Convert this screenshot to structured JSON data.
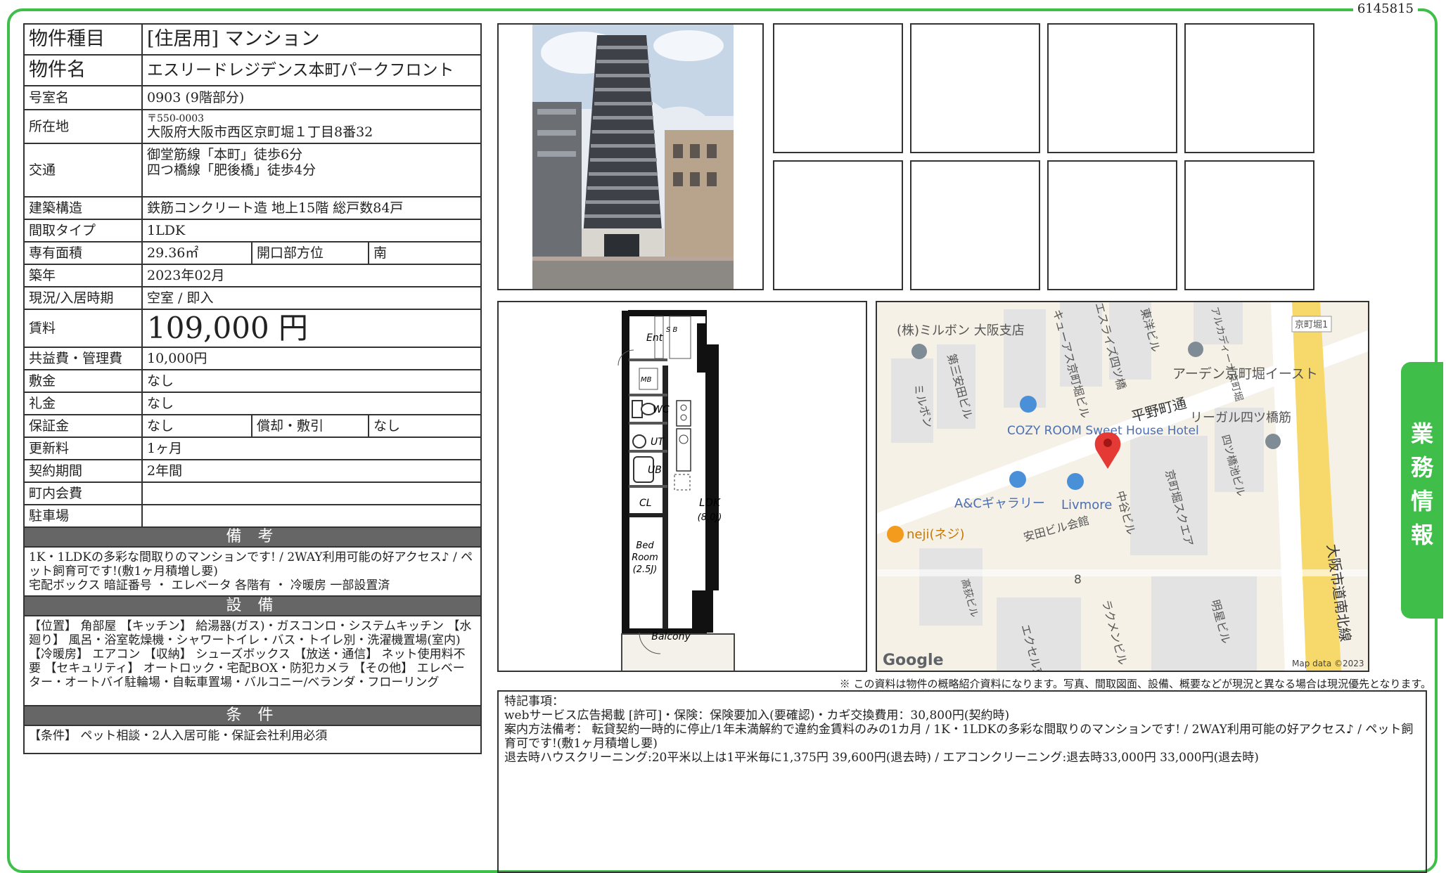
{
  "doc_id": "6145815",
  "side_tab": "業務情報",
  "property": {
    "type_label": "物件種目",
    "type_value": "[住居用] マンション",
    "name_label": "物件名",
    "name_value": "エスリードレジデンス本町パークフロント",
    "room_label": "号室名",
    "room_value": "0903 (9階部分)",
    "address_label": "所在地",
    "postal": "〒550-0003",
    "address": "大阪府大阪市西区京町堀１丁目8番32",
    "transport_label": "交通",
    "transport_1": "御堂筋線「本町」徒歩6分",
    "transport_2": "四つ橋線「肥後橋」徒歩4分",
    "structure_label": "建築構造",
    "structure_value": "鉄筋コンクリート造 地上15階 総戸数84戸",
    "layout_label": "間取タイプ",
    "layout_value": "1LDK",
    "area_label": "専有面積",
    "area_value": "29.36㎡",
    "direction_label": "開口部方位",
    "direction_value": "南",
    "built_label": "築年",
    "built_value": "2023年02月",
    "status_label": "現況/入居時期",
    "status_value": "空室 / 即入",
    "rent_label": "賃料",
    "rent_value": "109,000 円",
    "fee_label": "共益費・管理費",
    "fee_value": "10,000円",
    "deposit_label": "敷金",
    "deposit_value": "なし",
    "key_money_label": "礼金",
    "key_money_value": "なし",
    "guarantee_label": "保証金",
    "guarantee_value": "なし",
    "amortization_label": "償却・敷引",
    "amortization_value": "なし",
    "renewal_label": "更新料",
    "renewal_value": "1ヶ月",
    "contract_label": "契約期間",
    "contract_value": "2年間",
    "community_label": "町内会費",
    "community_value": "",
    "parking_label": "駐車場",
    "parking_value": ""
  },
  "sections": {
    "remarks_title": "備 考",
    "remarks_1": "1K・1LDKの多彩な間取りのマンションです! / 2WAY利用可能の好アクセス♪ / ペット飼育可です!(敷1ヶ月積増し要)",
    "remarks_2": "宅配ボックス 暗証番号 ・ エレベータ 各階有 ・ 冷暖房 一部設置済",
    "equip_title": "設 備",
    "equip_text": "【位置】 角部屋 【キッチン】 給湯器(ガス)・ガスコンロ・システムキッチン 【水廻り】 風呂・浴室乾燥機・シャワートイレ・バス・トイレ別・洗濯機置場(室内) 【冷暖房】 エアコン 【収納】 シューズボックス 【放送・通信】 ネット使用料不要 【セキュリティ】 オートロック・宅配BOX・防犯カメラ 【その他】 エレベーター・オートバイ駐輪場・自転車置場・バルコニー/ベランダ・フローリング",
    "cond_title": "条 件",
    "cond_text": "【条件】 ペット相談・2人入居可能・保証会社利用必須"
  },
  "floorplan": {
    "ent": "Ent",
    "sb": "S B",
    "mb": "MB",
    "wc": "WC",
    "ut": "UT",
    "ub": "UB",
    "cl": "CL",
    "ldk": "LDK",
    "ldk_size": "(8.0J)",
    "bed1": "Bed",
    "bed2": "Room",
    "bed_size": "(2.5J)",
    "balcony": "Balcony"
  },
  "map": {
    "labels": {
      "milbon_branch": "(株)ミルボン 大阪支店",
      "milbon": "ミルボン",
      "daisan": "第三安田ビル",
      "cure": "キューアス京町堀ビル",
      "eslide": "エスライズ四ツ橋",
      "toyo": "東洋ビル",
      "arca": "アルカディーナ京町堀",
      "kyomachi1": "京町堀1",
      "arden": "アーデン京町堀イースト",
      "hirano": "平野町通",
      "regal": "リーガル四ツ橋筋",
      "cozy": "COZY ROOM Sweet House Hotel",
      "ac": "A&Cギャラリー",
      "livmore": "Livmore",
      "nakatani": "中谷ビル",
      "kyomachi_sq": "京町堀スクエア",
      "yotsubashi_ike": "四ツ橋池ビル",
      "neji": "neji(ネジ)",
      "yasuda": "安田ビル会館",
      "block8": "8",
      "takazawa": "高荻ビル",
      "rakumen": "ラクメンビル",
      "excel": "エクセル京",
      "meisei": "明星ビル",
      "route": "大阪市道南北線"
    },
    "google": "Google",
    "attribution": "Map data ©2023"
  },
  "disclaimer": "※ この資料は物件の概略紹介資料になります。写真、間取図面、設備、概要などが現況と異なる場合は現況優先となります。",
  "special": {
    "title": "特記事項：",
    "line_1": "webサービス広告掲載 [許可]・保険：保険要加入(要確認)・カギ交換費用：30,800円(契約時)",
    "line_2": "案内方法備考： 転貸契約一時的に停止/1年未満解約で違約金賃料のみの1カ月 / 1K・1LDKの多彩な間取りのマンションです! / 2WAY利用可能の好アクセス♪ / ペット飼育可です!(敷1ヶ月積増し要)",
    "line_3": "退去時ハウスクリーニング:20平米以上は1平米毎に1,375円 39,600円(退去時) / エアコンクリーニング:退去時33,000円 33,000円(退去時)"
  },
  "colors": {
    "frame": "#3fbf4a",
    "section_bar": "#666666",
    "map_pin": "#e53935",
    "map_blue_pin": "#4a90d9"
  }
}
